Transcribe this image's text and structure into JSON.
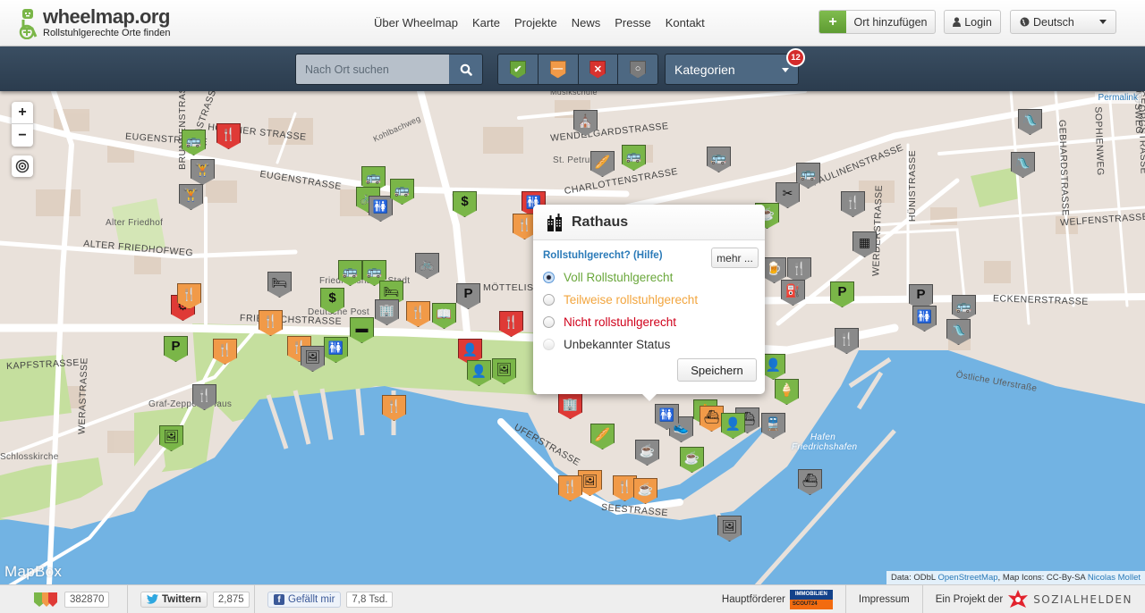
{
  "header": {
    "logo_title": "wheelmap.org",
    "logo_subtitle": "Rollstuhlgerechte Orte finden",
    "nav": [
      "Über Wheelmap",
      "Karte",
      "Projekte",
      "News",
      "Presse",
      "Kontakt"
    ],
    "add_place_label": "Ort hinzufügen",
    "login_label": "Login",
    "language_label": "Deutsch"
  },
  "toolbar": {
    "search_placeholder": "Nach Ort suchen",
    "filters": [
      {
        "status": "yes",
        "symbol": "✔",
        "color": "#6aa73b"
      },
      {
        "status": "limited",
        "symbol": "—",
        "color": "#f19a48"
      },
      {
        "status": "no",
        "symbol": "✕",
        "color": "#d8332f"
      },
      {
        "status": "unknown",
        "symbol": "○",
        "color": "#7b7b7b"
      }
    ],
    "categories_label": "Kategorien",
    "categories_badge": "12"
  },
  "map": {
    "permalink_label": "Permalink",
    "provider_label": "MapBox",
    "attribution_prefix": "Data: ODbL ",
    "attribution_osm": "OpenStreetMap",
    "attribution_mid": ", Map Icons: CC-By-SA ",
    "attribution_author": "Nicolas Mollet",
    "zoom_in": "+",
    "zoom_out": "−",
    "labels": [
      {
        "text": "EUGENSTRASSE",
        "kind": "street"
      },
      {
        "text": "EUGENSTRASSE",
        "kind": "street"
      },
      {
        "text": "OLGASTRASSE",
        "kind": "street"
      },
      {
        "text": "HOFENER STRASSE",
        "kind": "street"
      },
      {
        "text": "Kohlbachweg",
        "kind": "minor"
      },
      {
        "text": "WENDELGARDSTRASSE",
        "kind": "street"
      },
      {
        "text": "Musikschule",
        "kind": "minor"
      },
      {
        "text": "St. Petrus",
        "kind": "minor"
      },
      {
        "text": "CHARLOTTENSTRASSE",
        "kind": "street"
      },
      {
        "text": "Alter Friedhof",
        "kind": "place"
      },
      {
        "text": "ALTER FRIEDHOFWEG",
        "kind": "street"
      },
      {
        "text": "BRUNNENSTRASSE",
        "kind": "street"
      },
      {
        "text": "PAULINENSTRASSE",
        "kind": "street"
      },
      {
        "text": "MÖTTELISTRASSE",
        "kind": "street"
      },
      {
        "text": "Friedrichshafen Stadt",
        "kind": "place"
      },
      {
        "text": "Deutsche Post",
        "kind": "place"
      },
      {
        "text": "FRIEDRICHSTRASSE",
        "kind": "street"
      },
      {
        "text": "KAPFSTRASSE",
        "kind": "street"
      },
      {
        "text": "WERASTRASSE",
        "kind": "street"
      },
      {
        "text": "Graf-Zeppelin-Haus",
        "kind": "place"
      },
      {
        "text": "Schlosskirche",
        "kind": "place"
      },
      {
        "text": "UFERSTRASSE",
        "kind": "street"
      },
      {
        "text": "SEESTRASSE",
        "kind": "street"
      },
      {
        "text": "ECKENERSTRASSE",
        "kind": "street"
      },
      {
        "text": "HÜNISTRASSE",
        "kind": "street"
      },
      {
        "text": "WERDERSTRASSE",
        "kind": "street"
      },
      {
        "text": "GEBHARDSTRASSE",
        "kind": "street"
      },
      {
        "text": "SOPHIENWEG",
        "kind": "street"
      },
      {
        "text": "GEORGSTRASSE",
        "kind": "street"
      },
      {
        "text": "CLAUSWEG",
        "kind": "street"
      },
      {
        "text": "WELFENSTRASSE",
        "kind": "street"
      },
      {
        "text": "Östliche Uferstraße",
        "kind": "minor"
      },
      {
        "text": "Hafen Friedrichshafen",
        "kind": "water"
      }
    ],
    "markers": [
      {
        "icon": "bus-stop",
        "glyph": "🚌",
        "status": "yes"
      },
      {
        "icon": "restaurant",
        "glyph": "🍴",
        "status": "no"
      },
      {
        "icon": "gym",
        "glyph": "🏋",
        "status": "unknown"
      },
      {
        "icon": "gym",
        "glyph": "🏋",
        "status": "unknown"
      },
      {
        "icon": "bus-stop",
        "glyph": "🚌",
        "status": "yes"
      },
      {
        "icon": "bicycle",
        "glyph": "🚲",
        "status": "yes"
      },
      {
        "icon": "toilets",
        "glyph": "🚻",
        "status": "unknown"
      },
      {
        "icon": "bus-stop",
        "glyph": "🚌",
        "status": "yes"
      },
      {
        "icon": "bank",
        "glyph": "$",
        "status": "yes"
      },
      {
        "icon": "worship",
        "glyph": "⛪",
        "status": "unknown"
      },
      {
        "icon": "bakery",
        "glyph": "🥖",
        "status": "unknown"
      },
      {
        "icon": "bus-stop",
        "glyph": "🚌",
        "status": "yes"
      },
      {
        "icon": "bus-stop",
        "glyph": "🚌",
        "status": "unknown"
      },
      {
        "icon": "hairdresser",
        "glyph": "✂",
        "status": "unknown"
      },
      {
        "icon": "bus-stop",
        "glyph": "🚌",
        "status": "unknown"
      },
      {
        "icon": "playground",
        "glyph": "🛝",
        "status": "unknown"
      },
      {
        "icon": "restaurant",
        "glyph": "🍴",
        "status": "unknown"
      },
      {
        "icon": "cafe",
        "glyph": "☕",
        "status": "yes"
      },
      {
        "icon": "library",
        "glyph": "▦",
        "status": "unknown"
      },
      {
        "icon": "pub",
        "glyph": "🍺",
        "status": "unknown"
      },
      {
        "icon": "restaurant",
        "glyph": "🍴",
        "status": "unknown"
      },
      {
        "icon": "fuel",
        "glyph": "⛽",
        "status": "unknown"
      },
      {
        "icon": "parking",
        "glyph": "P",
        "status": "yes"
      },
      {
        "icon": "parking",
        "glyph": "P",
        "status": "unknown"
      },
      {
        "icon": "bus-stop",
        "glyph": "🚌",
        "status": "unknown"
      },
      {
        "icon": "toilets",
        "glyph": "🚻",
        "status": "unknown"
      },
      {
        "icon": "playground",
        "glyph": "🛝",
        "status": "unknown"
      },
      {
        "icon": "restaurant",
        "glyph": "🍴",
        "status": "unknown"
      },
      {
        "icon": "playground",
        "glyph": "🛝",
        "status": "unknown"
      },
      {
        "icon": "toilets",
        "glyph": "🚻",
        "status": "no"
      },
      {
        "icon": "restaurant",
        "glyph": "🍴",
        "status": "orange"
      },
      {
        "icon": "bus-stop",
        "glyph": "🚌",
        "status": "yes"
      },
      {
        "icon": "bus-stop",
        "glyph": "🚌",
        "status": "yes"
      },
      {
        "icon": "bicycle",
        "glyph": "🚲",
        "status": "unknown"
      },
      {
        "icon": "hotel",
        "glyph": "🛏",
        "status": "unknown"
      },
      {
        "icon": "bank",
        "glyph": "$",
        "status": "yes"
      },
      {
        "icon": "hotel",
        "glyph": "🛏",
        "status": "yes"
      },
      {
        "icon": "townhall",
        "glyph": "🏢",
        "status": "unknown"
      },
      {
        "icon": "restaurant",
        "glyph": "🍴",
        "status": "orange"
      },
      {
        "icon": "reading",
        "glyph": "📖",
        "status": "yes"
      },
      {
        "icon": "parking",
        "glyph": "P",
        "status": "unknown"
      },
      {
        "icon": "restaurant",
        "glyph": "🍴",
        "status": "no"
      },
      {
        "icon": "restaurant",
        "glyph": "🍴",
        "status": "orange"
      },
      {
        "icon": "restaurant",
        "glyph": "🍴",
        "status": "orange"
      },
      {
        "icon": "memorial",
        "glyph": "▬",
        "status": "yes"
      },
      {
        "icon": "toilets",
        "glyph": "🚻",
        "status": "yes"
      },
      {
        "icon": "museum",
        "glyph": "🖼",
        "status": "unknown"
      },
      {
        "icon": "restaurant",
        "glyph": "🍴",
        "status": "orange"
      },
      {
        "icon": "bicycle-repair",
        "glyph": "⚙",
        "status": "no"
      },
      {
        "icon": "restaurant",
        "glyph": "🍴",
        "status": "orange"
      },
      {
        "icon": "parking",
        "glyph": "P",
        "status": "yes"
      },
      {
        "icon": "restaurant",
        "glyph": "🍴",
        "status": "unknown"
      },
      {
        "icon": "museum",
        "glyph": "🖼",
        "status": "yes"
      },
      {
        "icon": "restaurant",
        "glyph": "🍴",
        "status": "orange"
      },
      {
        "icon": "monument",
        "glyph": "👤",
        "status": "no"
      },
      {
        "icon": "monument",
        "glyph": "👤",
        "status": "yes"
      },
      {
        "icon": "museum",
        "glyph": "🖼",
        "status": "yes"
      },
      {
        "icon": "monument",
        "glyph": "👤",
        "status": "yes"
      },
      {
        "icon": "ferry",
        "glyph": "⛴",
        "status": "unknown"
      },
      {
        "icon": "ferry",
        "glyph": "⛴",
        "status": "unknown"
      },
      {
        "icon": "museum",
        "glyph": "🖼",
        "status": "unknown"
      },
      {
        "icon": "museum",
        "glyph": "🖼",
        "status": "orange"
      },
      {
        "icon": "restaurant",
        "glyph": "🍴",
        "status": "orange"
      },
      {
        "icon": "cafe",
        "glyph": "☕",
        "status": "orange"
      },
      {
        "icon": "restaurant",
        "glyph": "🍴",
        "status": "orange"
      },
      {
        "icon": "cafe",
        "glyph": "☕",
        "status": "unknown"
      },
      {
        "icon": "bakery",
        "glyph": "🥖",
        "status": "yes"
      },
      {
        "icon": "shoes",
        "glyph": "👟",
        "status": "unknown"
      },
      {
        "icon": "toilets",
        "glyph": "🚻",
        "status": "unknown"
      },
      {
        "icon": "worship",
        "glyph": "🙏",
        "status": "yes"
      },
      {
        "icon": "townhall",
        "glyph": "🏢",
        "status": "no"
      },
      {
        "icon": "ice-cream",
        "glyph": "🍦",
        "status": "yes"
      },
      {
        "icon": "ferry",
        "glyph": "⛴",
        "status": "orange"
      },
      {
        "icon": "reading",
        "glyph": "👤",
        "status": "yes"
      },
      {
        "icon": "train",
        "glyph": "🚆",
        "status": "unknown"
      },
      {
        "icon": "cafe",
        "glyph": "☕",
        "status": "yes"
      }
    ]
  },
  "popup": {
    "title": "Rathaus",
    "title_icon": "townhall",
    "help_label": "Rollstuhlgerecht? (Hilfe)",
    "more_label": "mehr ...",
    "options": [
      {
        "label": "Voll Rollstuhlgerecht",
        "color": "#6aa73b",
        "selected": true
      },
      {
        "label": "Teilweise rollstuhlgerecht",
        "color": "#f2a53e",
        "selected": false
      },
      {
        "label": "Nicht rollstuhlgerecht",
        "color": "#d0021b",
        "selected": false
      },
      {
        "label": "Unbekannter Status",
        "color": "#333333",
        "selected": false
      }
    ],
    "save_label": "Speichern"
  },
  "footer": {
    "places_count": "382870",
    "twitter_label": "Twittern",
    "twitter_count": "2,875",
    "facebook_label": "Gefällt mir",
    "facebook_count": "7,8 Tsd.",
    "sponsor_label": "Hauptförderer",
    "sponsor_logo_top": "IMMOBILIEN",
    "sponsor_logo_bottom": "SCOUT24",
    "imprint_label": "Impressum",
    "project_label": "Ein Projekt der",
    "org_label": "SOZIALHELDEN"
  },
  "colors": {
    "yes": "#7ab648",
    "orange": "#f19a48",
    "no": "#df3a36",
    "unknown": "#8a8a8a",
    "water": "#72b3e3",
    "toolbar": "#33465a"
  }
}
